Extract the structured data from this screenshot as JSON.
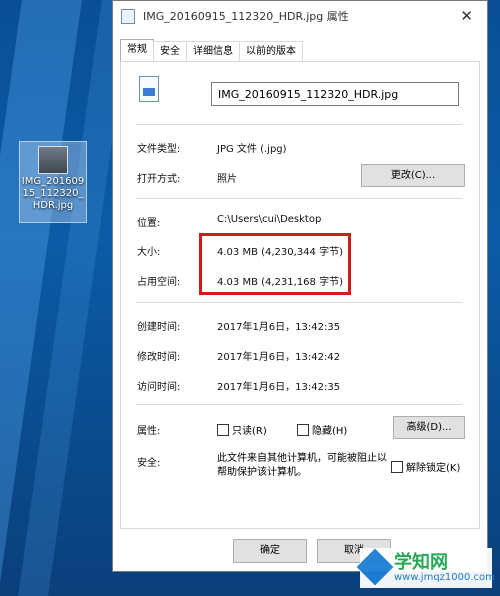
{
  "desktop": {
    "icon_label": "IMG_201609 15_112320_ HDR.jpg"
  },
  "window": {
    "title": "IMG_20160915_112320_HDR.jpg 属性",
    "close_glyph": "✕"
  },
  "tabs": [
    {
      "label": "常规"
    },
    {
      "label": "安全"
    },
    {
      "label": "详细信息"
    },
    {
      "label": "以前的版本"
    }
  ],
  "general": {
    "filename": "IMG_20160915_112320_HDR.jpg",
    "file_type_label": "文件类型:",
    "file_type_value": "JPG 文件 (.jpg)",
    "opens_with_label": "打开方式:",
    "opens_with_value": "照片",
    "change_button": "更改(C)...",
    "location_label": "位置:",
    "location_value": "C:\\Users\\cui\\Desktop",
    "size_label": "大小:",
    "size_value": "4.03 MB (4,230,344 字节)",
    "size_on_disk_label": "占用空间:",
    "size_on_disk_value": "4.03 MB (4,231,168 字节)",
    "created_label": "创建时间:",
    "created_value": "2017年1月6日，13:42:35",
    "modified_label": "修改时间:",
    "modified_value": "2017年1月6日，13:42:42",
    "accessed_label": "访问时间:",
    "accessed_value": "2017年1月6日，13:42:35",
    "attributes_label": "属性:",
    "readonly_label": "只读(R)",
    "hidden_label": "隐藏(H)",
    "advanced_button": "高级(D)...",
    "security_label": "安全:",
    "security_text": "此文件来自其他计算机，可能被阻止以帮助保护该计算机。",
    "unblock_label": "解除锁定(K)"
  },
  "footer": {
    "ok_button": "确定",
    "cancel_button": "取消"
  },
  "watermark": {
    "title": "学知网",
    "url": "www.jmqz1000.com"
  },
  "colors": {
    "highlight": "#d11a1a",
    "desktop": "#0b5ba6"
  }
}
